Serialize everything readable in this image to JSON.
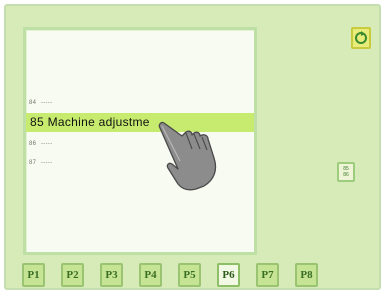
{
  "list": {
    "items": [
      {
        "number": "84",
        "label": "-----"
      },
      {
        "number": "85",
        "label": "Machine adjustme",
        "selected": true
      },
      {
        "number": "86",
        "label": "-----"
      },
      {
        "number": "87",
        "label": "-----"
      }
    ]
  },
  "side_button": {
    "top": "85",
    "bottom": "86"
  },
  "tabs": [
    "P1",
    "P2",
    "P3",
    "P4",
    "P5",
    "P6",
    "P7",
    "P8"
  ],
  "active_tab": "P6",
  "icons": {
    "top_right": "rotate-icon",
    "pointer": "hand-pointer-icon"
  },
  "colors": {
    "screen_bg": "#d6ebb8",
    "selected_row": "#c6eb6e",
    "tab_bg": "#c5e594",
    "tab_text": "#3b6e25",
    "accent_button": "#e7ec7a"
  }
}
